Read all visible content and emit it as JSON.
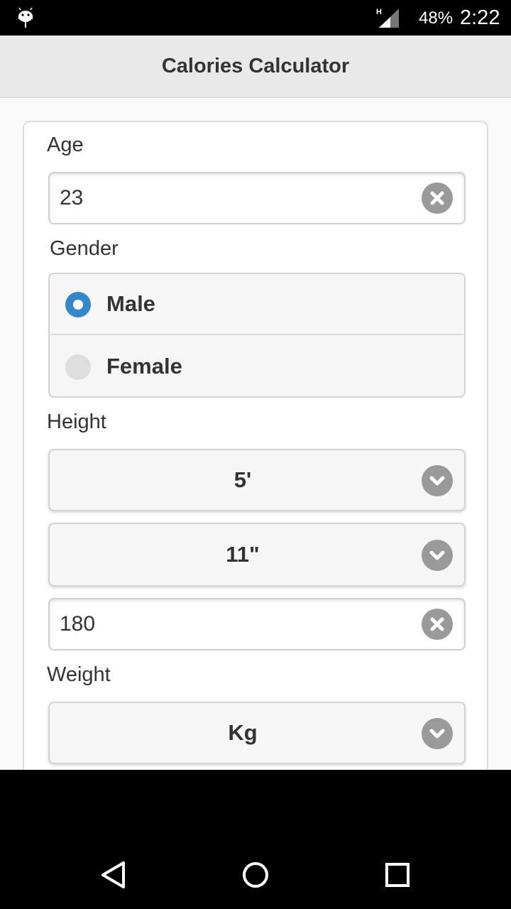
{
  "status_bar": {
    "network": "H",
    "battery": "48%",
    "time": "2:22"
  },
  "header": {
    "title": "Calories Calculator"
  },
  "form": {
    "age": {
      "label": "Age",
      "value": "23"
    },
    "gender": {
      "label": "Gender",
      "options": [
        {
          "label": "Male",
          "selected": true
        },
        {
          "label": "Female",
          "selected": false
        }
      ]
    },
    "height": {
      "label": "Height",
      "feet": "5'",
      "inches": "11\"",
      "cm_value": "180"
    },
    "weight": {
      "label": "Weight",
      "unit": "Kg"
    }
  },
  "colors": {
    "accent": "#3388cc",
    "header_bg": "#e9e9e9",
    "icon_gray": "#9a9a9a"
  },
  "icons": [
    "android-icon",
    "signal-icon",
    "clear-icon",
    "chevron-down-icon",
    "back-icon",
    "home-icon",
    "recents-icon"
  ]
}
